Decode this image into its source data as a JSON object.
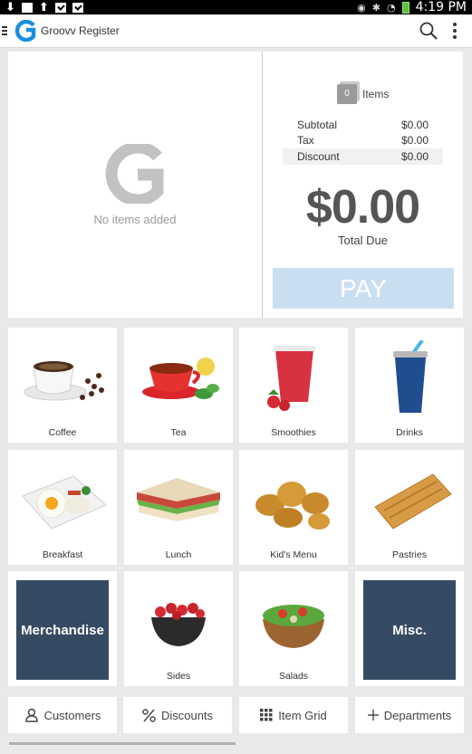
{
  "status_bar": {
    "time": "4:19 PM",
    "icons": [
      "download-icon",
      "mail-icon",
      "upload-icon",
      "check-icon",
      "check-icon",
      "eye-icon",
      "bluetooth-icon",
      "wifi-icon",
      "battery-icon"
    ]
  },
  "app_bar": {
    "title": "Groovv Register",
    "icons": [
      "menu-icon",
      "groovv-logo",
      "search-icon",
      "more-vert-icon"
    ]
  },
  "cart": {
    "empty_text": "No items added",
    "item_count": "0",
    "items_label": "Items",
    "subtotal_label": "Subtotal",
    "subtotal_value": "$0.00",
    "tax_label": "Tax",
    "tax_value": "$0.00",
    "discount_label": "Discount",
    "discount_value": "$0.00",
    "total": "$0.00",
    "total_label": "Total Due",
    "pay_label": "PAY"
  },
  "categories": [
    {
      "label": "Coffee"
    },
    {
      "label": "Tea"
    },
    {
      "label": "Smoothies"
    },
    {
      "label": "Drinks"
    },
    {
      "label": "Breakfast"
    },
    {
      "label": "Lunch"
    },
    {
      "label": "Kid's Menu"
    },
    {
      "label": "Pastries"
    },
    {
      "label": "Merchandise"
    },
    {
      "label": "Sides"
    },
    {
      "label": "Salads"
    },
    {
      "label": "Misc."
    }
  ],
  "bottom_nav": {
    "customers": "Customers",
    "discounts": "Discounts",
    "item_grid": "Item Grid",
    "departments": "Departments"
  },
  "colors": {
    "accent": "#1a8fe0",
    "pay_button": "#c9dff1",
    "dark_tile": "#354b63"
  }
}
